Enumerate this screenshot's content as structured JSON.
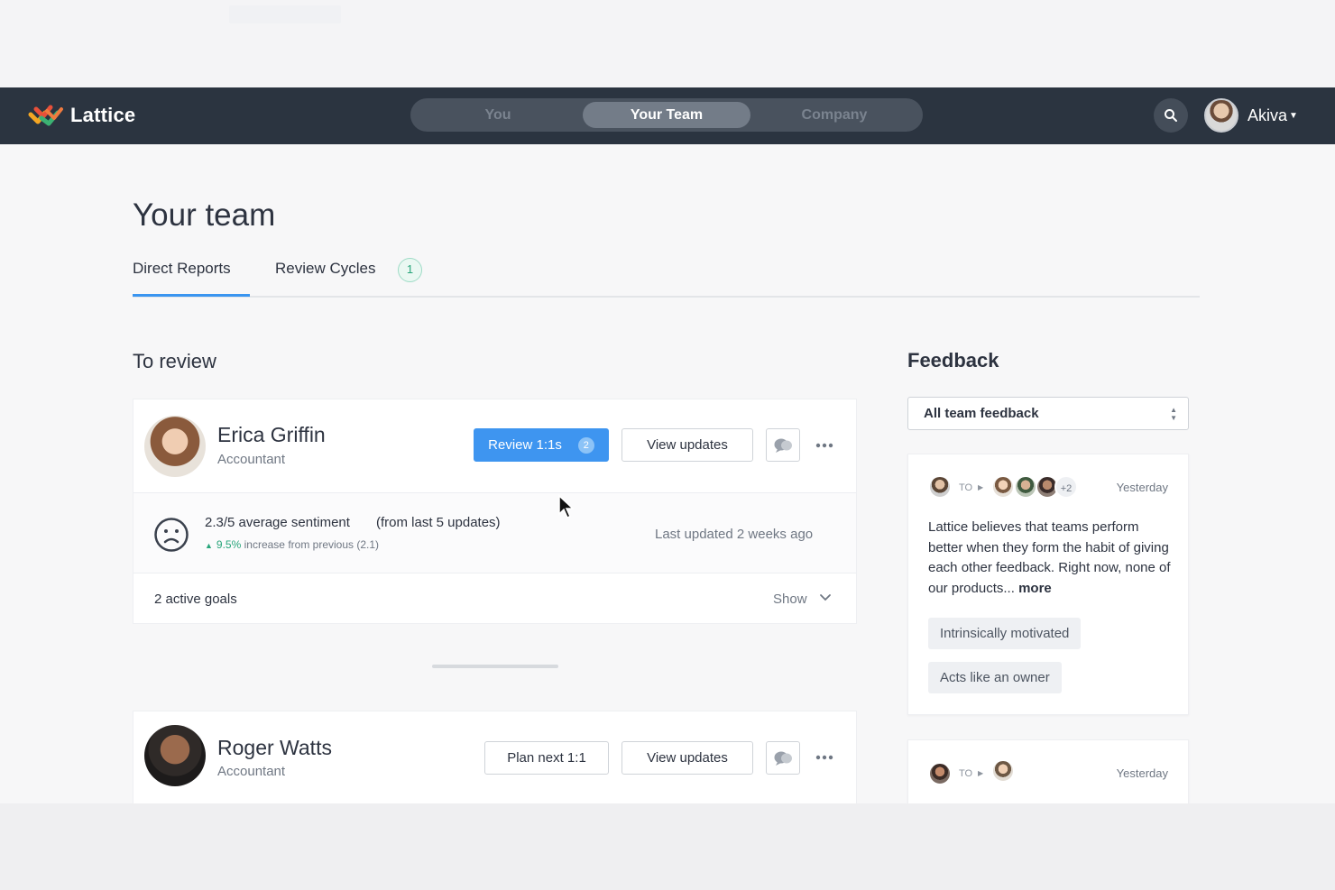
{
  "app": {
    "name": "Lattice",
    "colors": {
      "nav_bg": "#2b3440",
      "primary": "#3e95f0",
      "positive": "#27a57a"
    }
  },
  "nav": {
    "segments": [
      {
        "label": "You",
        "active": false
      },
      {
        "label": "Your Team",
        "active": true
      },
      {
        "label": "Company",
        "active": false
      }
    ],
    "search_icon": "search-icon",
    "user": {
      "name": "Akiva"
    }
  },
  "page": {
    "title": "Your team",
    "tabs": [
      {
        "label": "Direct Reports",
        "active": true
      },
      {
        "label": "Review Cycles",
        "badge": "1"
      }
    ]
  },
  "to_review": {
    "title": "To review",
    "people": [
      {
        "name": "Erica Griffin",
        "role": "Accountant",
        "primary_action": {
          "label": "Review 1:1s",
          "badge": "2"
        },
        "secondary_action": "View updates",
        "sentiment": {
          "main": "2.3/5 average sentiment",
          "from": "(from last 5 updates)",
          "change_pct": "9.5%",
          "change_text": "increase from previous (2.1)",
          "last_updated": "Last updated 2 weeks ago"
        },
        "goals": {
          "text": "2 active goals",
          "toggle": "Show"
        }
      },
      {
        "name": "Roger Watts",
        "role": "Accountant",
        "primary_action": {
          "label": "Plan next 1:1"
        },
        "secondary_action": "View updates"
      }
    ]
  },
  "feedback": {
    "title": "Feedback",
    "filter": "All team feedback",
    "items": [
      {
        "to_label": "TO",
        "extra_recipients": "+2",
        "date": "Yesterday",
        "body": "Lattice believes that teams perform better when they form the habit of giving each other feedback. Right now, none of our products...",
        "more_label": "more",
        "tags": [
          "Intrinsically motivated",
          "Acts like an owner"
        ]
      },
      {
        "to_label": "TO",
        "date": "Yesterday"
      }
    ]
  }
}
